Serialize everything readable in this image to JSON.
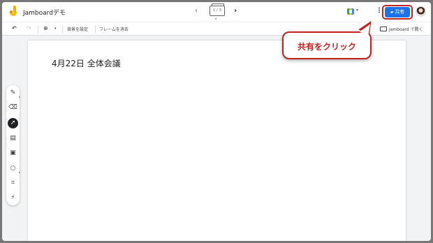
{
  "app": {
    "title": "Jamboardデモ"
  },
  "frame_nav": {
    "prev": "‹",
    "counter": "1 / 3",
    "next": "›"
  },
  "header": {
    "share_label": "共有",
    "more": "⋮"
  },
  "toolbar": {
    "undo": "↶",
    "redo": "↷",
    "zoom": "⊕",
    "zoom_chevron": "▾",
    "set_background": "背景を設定",
    "clear_frame": "フレームを消去",
    "open_in_jamboard": "Jamboard で開く"
  },
  "canvas": {
    "text": "4月22日 全体会議"
  },
  "tools": [
    {
      "icon": "pen-icon",
      "glyph": "✎"
    },
    {
      "icon": "eraser-icon",
      "glyph": "⌫"
    },
    {
      "icon": "select-icon",
      "glyph": "➚"
    },
    {
      "icon": "sticky-note-icon",
      "glyph": "▤"
    },
    {
      "icon": "image-icon",
      "glyph": "▣"
    },
    {
      "icon": "circle-icon",
      "glyph": "○"
    },
    {
      "icon": "text-box-icon",
      "glyph": "⌗"
    },
    {
      "icon": "laser-icon",
      "glyph": "⚡"
    }
  ],
  "callout": {
    "text": "共有をクリック"
  },
  "colors": {
    "accent": "#1a73e8",
    "callout": "#c5221f"
  }
}
